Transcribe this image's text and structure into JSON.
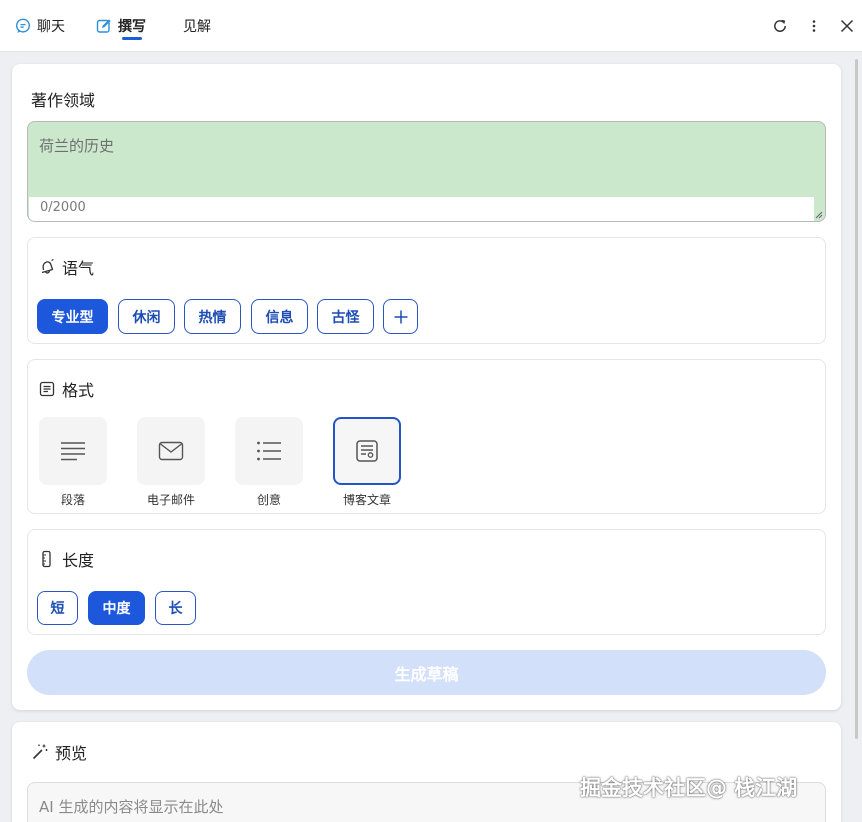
{
  "tabs": [
    {
      "label": "聊天",
      "icon": "chat-bubble-icon",
      "active": false
    },
    {
      "label": "撰写",
      "icon": "compose-icon",
      "active": true
    },
    {
      "label": "见解",
      "icon": "",
      "active": false
    }
  ],
  "toolbar": {
    "refresh_icon": "refresh-icon",
    "more_icon": "more-vertical-icon",
    "close_icon": "close-icon"
  },
  "topic": {
    "title": "著作领域",
    "placeholder": "荷兰的历史",
    "value": "",
    "counter": "0/2000"
  },
  "tone": {
    "title": "语气",
    "icon": "bell-icon",
    "options": [
      "专业型",
      "休闲",
      "热情",
      "信息",
      "古怪"
    ],
    "selected": "专业型",
    "add_icon": "plus-icon"
  },
  "format": {
    "title": "格式",
    "icon": "document-icon",
    "options": [
      {
        "label": "段落",
        "icon": "paragraph-icon"
      },
      {
        "label": "电子邮件",
        "icon": "mail-icon"
      },
      {
        "label": "创意",
        "icon": "list-icon"
      },
      {
        "label": "博客文章",
        "icon": "blog-post-icon"
      }
    ],
    "selected": "博客文章"
  },
  "length": {
    "title": "长度",
    "icon": "ruler-icon",
    "options": [
      "短",
      "中度",
      "长"
    ],
    "selected": "中度"
  },
  "generate_button": "生成草稿",
  "preview": {
    "title": "预览",
    "icon": "magic-wand-icon",
    "placeholder": "AI 生成的内容将显示在此处"
  },
  "watermark": "掘金技术社区@ 栈江湖",
  "colors": {
    "accent": "#1c57dc",
    "topic_bg": "#cbe8cd",
    "generate_disabled": "#d3e0fa"
  }
}
